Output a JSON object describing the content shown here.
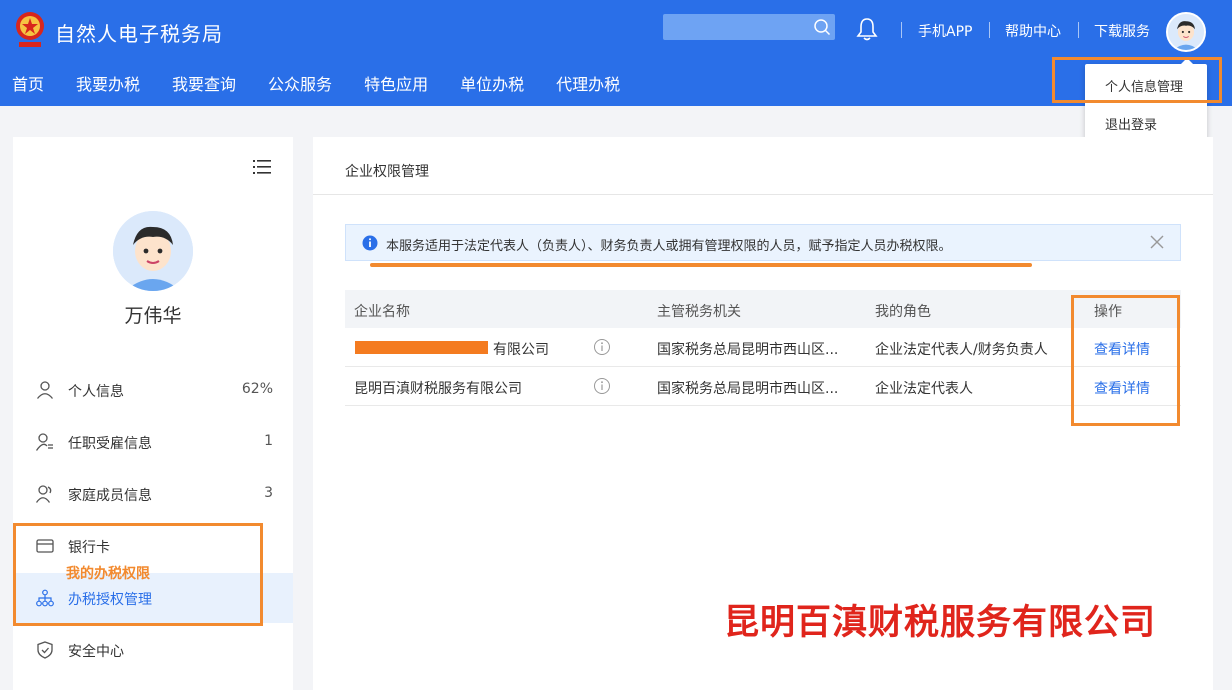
{
  "header": {
    "title": "自然人电子税务局",
    "links": [
      "手机APP",
      "帮助中心",
      "下载服务"
    ],
    "nav": [
      "首页",
      "我要办税",
      "我要查询",
      "公众服务",
      "特色应用",
      "单位办税",
      "代理办税"
    ],
    "dropdown": [
      "个人信息管理",
      "退出登录"
    ]
  },
  "sidebar": {
    "user_name": "万伟华",
    "items": [
      {
        "label": "个人信息",
        "count": "62%",
        "icon": "user-icon"
      },
      {
        "label": "任职受雇信息",
        "count": "1",
        "icon": "user-list-icon"
      },
      {
        "label": "家庭成员信息",
        "count": "3",
        "icon": "family-icon"
      },
      {
        "label": "银行卡",
        "count": "",
        "icon": "bank-card-icon"
      },
      {
        "label": "办税授权管理",
        "count": "",
        "icon": "org-tree-icon",
        "active": true
      },
      {
        "label": "安全中心",
        "count": "",
        "icon": "shield-icon"
      }
    ]
  },
  "main": {
    "title": "企业权限管理",
    "notice": "本服务适用于法定代表人（负责人）、财务负责人或拥有管理权限的人员，赋予指定人员办税权限。",
    "table": {
      "headers": [
        "企业名称",
        "主管税务机关",
        "我的角色",
        "操作"
      ],
      "rows": [
        {
          "company": "有限公司",
          "authority": "国家税务总局昆明市西山区...",
          "role": "企业法定代表人/财务负责人",
          "action": "查看详情",
          "redacted": true
        },
        {
          "company": "昆明百滇财税服务有限公司",
          "authority": "国家税务总局昆明市西山区...",
          "role": "企业法定代表人",
          "action": "查看详情",
          "redacted": false
        }
      ]
    }
  },
  "annotations": {
    "my_tax_rights": "我的办税权限",
    "company_caption": "昆明百滇财税服务有限公司"
  },
  "colors": {
    "header_blue": "#2a6fe8",
    "highlight_orange": "#f28a2f",
    "caption_red": "#e0251c"
  }
}
